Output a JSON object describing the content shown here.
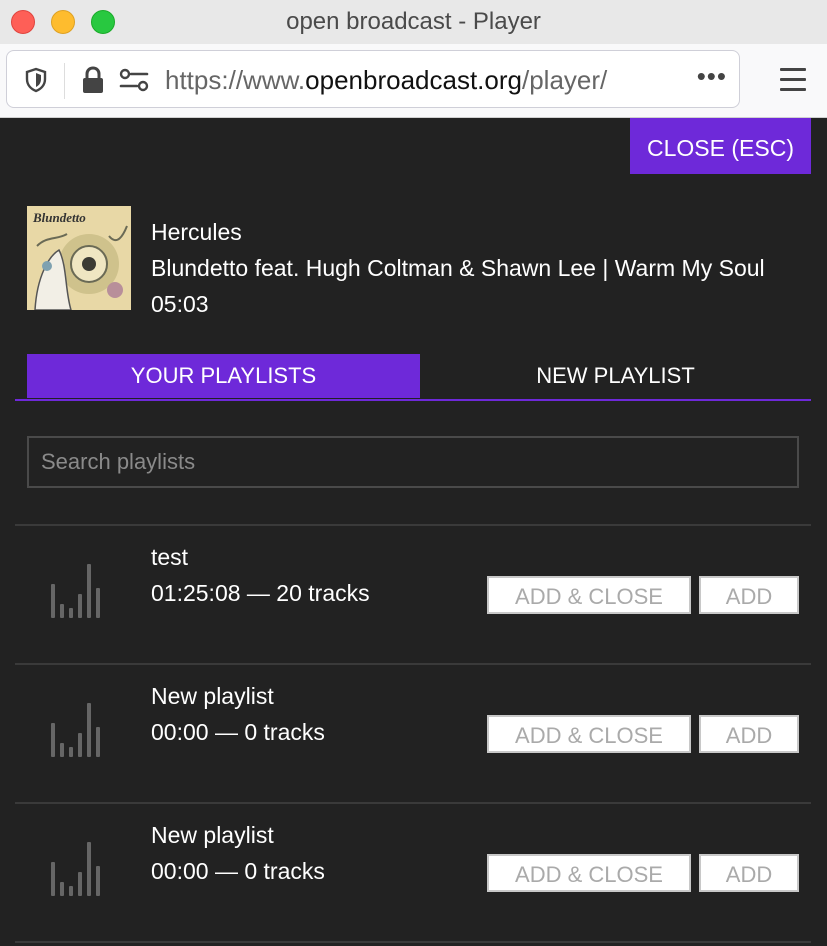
{
  "window": {
    "title": "open broadcast - Player"
  },
  "browser": {
    "url_prefix": "https://www.",
    "url_domain": "openbroadcast.org",
    "url_path": "/player/",
    "more_label": "•••"
  },
  "player": {
    "close_label": "CLOSE (ESC)",
    "track": {
      "title": "Hercules",
      "artist_release": "Blundetto feat. Hugh Coltman & Shawn Lee | Warm My Soul",
      "duration": "05:03",
      "cover_text": "Blundetto"
    },
    "tabs": [
      {
        "label": "YOUR PLAYLISTS",
        "active": true
      },
      {
        "label": "NEW PLAYLIST",
        "active": false
      }
    ],
    "search": {
      "placeholder": "Search playlists",
      "value": ""
    },
    "playlists": [
      {
        "name": "test",
        "meta": "01:25:08 — 20 tracks",
        "add_close_label": "ADD & CLOSE",
        "add_label": "ADD"
      },
      {
        "name": "New playlist",
        "meta": "00:00 — 0 tracks",
        "add_close_label": "ADD & CLOSE",
        "add_label": "ADD"
      },
      {
        "name": "New playlist",
        "meta": "00:00 — 0 tracks",
        "add_close_label": "ADD & CLOSE",
        "add_label": "ADD"
      }
    ]
  },
  "colors": {
    "accent": "#6e29d9",
    "background": "#222222"
  }
}
